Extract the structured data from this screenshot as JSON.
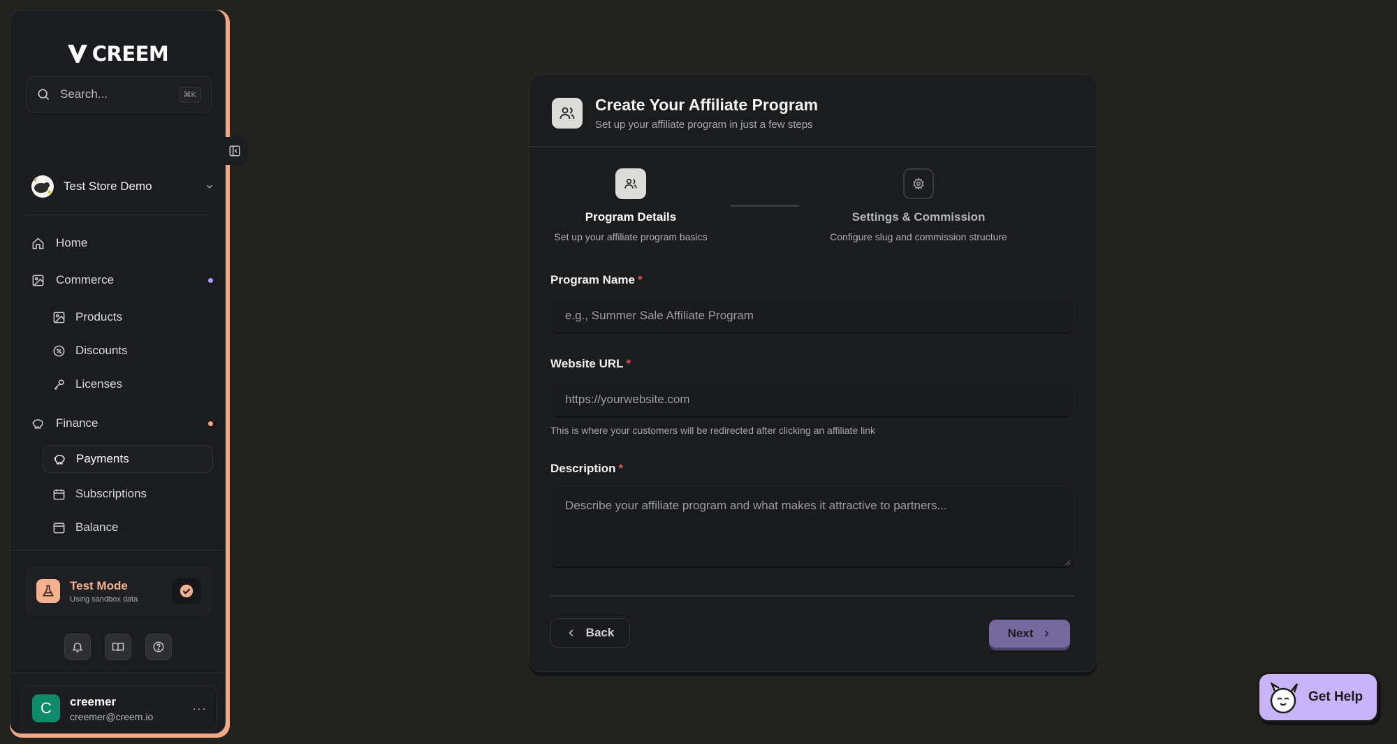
{
  "brand": {
    "name": "CREEM"
  },
  "search": {
    "placeholder": "Search...",
    "shortcut": "⌘K"
  },
  "store": {
    "name": "Test Store Demo"
  },
  "nav": {
    "home": "Home",
    "commerce": "Commerce",
    "products": "Products",
    "discounts": "Discounts",
    "licenses": "Licenses",
    "finance": "Finance",
    "payments": "Payments",
    "subscriptions": "Subscriptions",
    "balance": "Balance"
  },
  "colors": {
    "commerce_dot": "#a99cf0",
    "finance_dot": "#f4a47e",
    "accent": "#75699e"
  },
  "test_mode": {
    "title": "Test Mode",
    "subtitle": "Using sandbox data"
  },
  "user": {
    "initial": "C",
    "name": "creemer",
    "email": "creemer@creem.io"
  },
  "card": {
    "title": "Create Your Affiliate Program",
    "subtitle": "Set up your affiliate program in just a few steps"
  },
  "steps": [
    {
      "title": "Program Details",
      "subtitle": "Set up your affiliate program basics"
    },
    {
      "title": "Settings & Commission",
      "subtitle": "Configure slug and commission structure"
    }
  ],
  "form": {
    "program_name": {
      "label": "Program Name",
      "required": "*",
      "placeholder": "e.g., Summer Sale Affiliate Program"
    },
    "website_url": {
      "label": "Website URL",
      "required": "*",
      "placeholder": "https://yourwebsite.com",
      "help": "This is where your customers will be redirected after clicking an affiliate link"
    },
    "description": {
      "label": "Description",
      "required": "*",
      "placeholder": "Describe your affiliate program and what makes it attractive to partners..."
    }
  },
  "buttons": {
    "back": "Back",
    "next": "Next"
  },
  "help": {
    "label": "Get Help"
  }
}
